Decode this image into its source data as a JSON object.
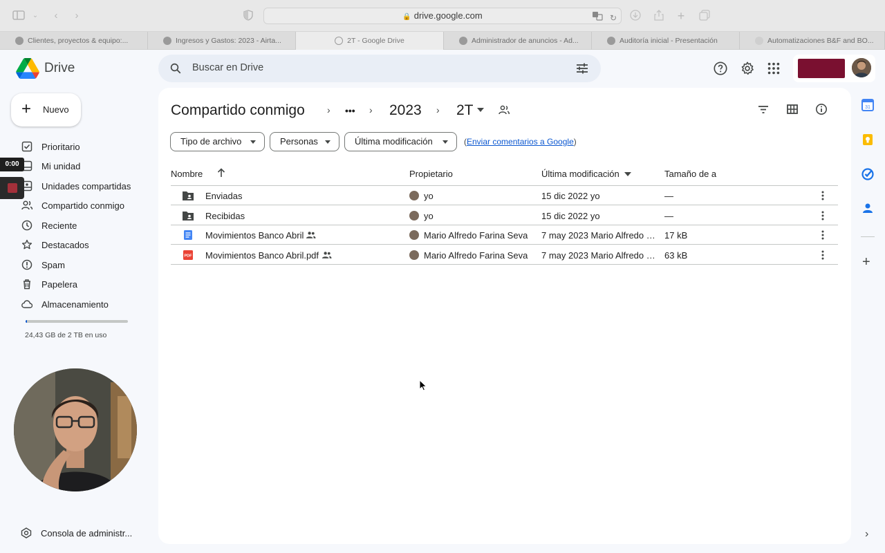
{
  "browser": {
    "url": "drive.google.com",
    "tabs": [
      {
        "title": "Clientes, proyectos & equipo:...",
        "active": false
      },
      {
        "title": "Ingresos y Gastos: 2023 - Airta...",
        "active": false
      },
      {
        "title": "2T - Google Drive",
        "active": true
      },
      {
        "title": "Administrador de anuncios - Ad...",
        "active": false
      },
      {
        "title": "Auditoría inicial - Presentación",
        "active": false
      },
      {
        "title": "Automatizaciones B&F and BO...",
        "active": false
      }
    ]
  },
  "app": {
    "name": "Drive",
    "search_placeholder": "Buscar en Drive"
  },
  "sidebar": {
    "new_label": "Nuevo",
    "items": [
      {
        "label": "Prioritario",
        "icon": "priority-icon"
      },
      {
        "label": "Mi unidad",
        "icon": "my-drive-icon"
      },
      {
        "label": "Unidades compartidas",
        "icon": "shared-drives-icon"
      },
      {
        "label": "Compartido conmigo",
        "icon": "shared-with-me-icon"
      },
      {
        "label": "Reciente",
        "icon": "clock-icon"
      },
      {
        "label": "Destacados",
        "icon": "star-icon"
      },
      {
        "label": "Spam",
        "icon": "spam-icon"
      },
      {
        "label": "Papelera",
        "icon": "trash-icon"
      },
      {
        "label": "Almacenamiento",
        "icon": "cloud-icon"
      }
    ],
    "storage_text": "24,43 GB de 2 TB en uso",
    "storage_fraction": 0.012,
    "console_label": "Consola de administr..."
  },
  "recording": {
    "time": "0:00"
  },
  "breadcrumb": {
    "root": "Compartido conmigo",
    "more": "•••",
    "level1": "2023",
    "current": "2T"
  },
  "filters": {
    "type": "Tipo de archivo",
    "people": "Personas",
    "modified": "Última modificación",
    "feedback_prefix": "(",
    "feedback_link": "Enviar comentarios a Google",
    "feedback_suffix": ")"
  },
  "table": {
    "columns": {
      "name": "Nombre",
      "owner": "Propietario",
      "modified": "Última modificación",
      "size": "Tamaño de a"
    },
    "rows": [
      {
        "type": "shared-folder",
        "name": "Enviadas",
        "shared": false,
        "owner": "yo",
        "modified": "15 dic 2022 yo",
        "size": "—"
      },
      {
        "type": "shared-folder",
        "name": "Recibidas",
        "shared": false,
        "owner": "yo",
        "modified": "15 dic 2022 yo",
        "size": "—"
      },
      {
        "type": "doc",
        "name": "Movimientos Banco Abril",
        "shared": true,
        "owner": "Mario Alfredo Farina Seva",
        "modified": "7 may 2023 Mario Alfredo F...",
        "size": "17 kB"
      },
      {
        "type": "pdf",
        "name": "Movimientos Banco Abril.pdf",
        "shared": true,
        "owner": "Mario Alfredo Farina Seva",
        "modified": "7 may 2023 Mario Alfredo F...",
        "size": "63 kB"
      }
    ]
  },
  "colors": {
    "accent": "#0b57d0",
    "background": "#f6f8fc",
    "search_bg": "#e9eef6",
    "pdf_red": "#ea4335",
    "doc_blue": "#4285f4"
  }
}
